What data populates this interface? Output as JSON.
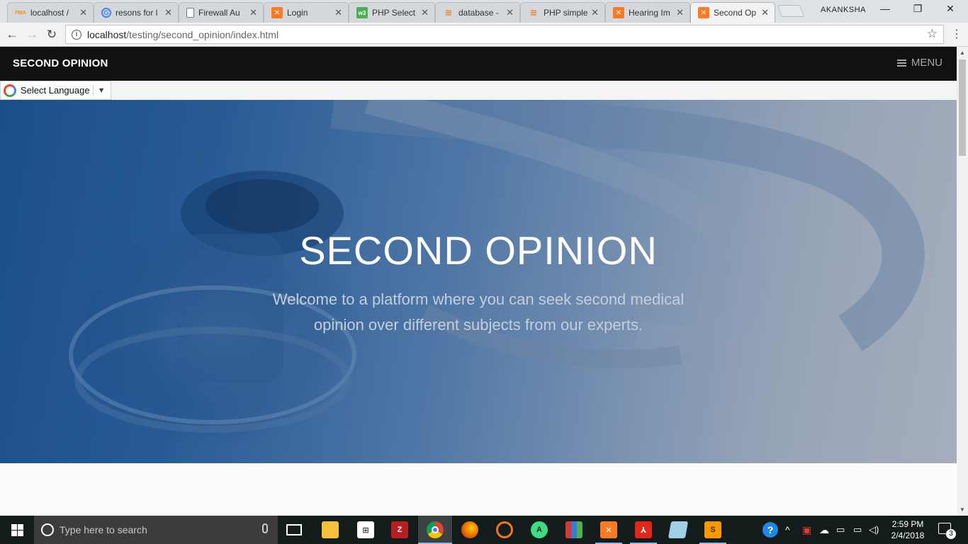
{
  "browser": {
    "tabs": [
      {
        "title": "localhost /",
        "favicon": "phpmyadmin-icon",
        "favicon_text": "PMA",
        "color": "#f29111"
      },
      {
        "title": "resons for l",
        "favicon": "google-icon",
        "favicon_text": "G",
        "color": "#4285f4"
      },
      {
        "title": "Firewall Au",
        "favicon": "document-icon",
        "favicon_text": "",
        "color": "#888888"
      },
      {
        "title": "Login",
        "favicon": "xampp-icon",
        "favicon_text": "☒",
        "color": "#fb7a24"
      },
      {
        "title": "PHP Select",
        "favicon": "w3schools-icon",
        "favicon_text": "w3",
        "color": "#4caf50"
      },
      {
        "title": "database -",
        "favicon": "stackoverflow-icon",
        "favicon_text": "≋",
        "color": "#f48024"
      },
      {
        "title": "PHP simple",
        "favicon": "stackoverflow-icon",
        "favicon_text": "≋",
        "color": "#f48024"
      },
      {
        "title": "Hearing Im",
        "favicon": "xampp-icon",
        "favicon_text": "☒",
        "color": "#fb7a24"
      },
      {
        "title": "Second Op",
        "favicon": "xampp-icon",
        "favicon_text": "☒",
        "color": "#fb7a24",
        "active": true
      }
    ],
    "profile": "AKANKSHA",
    "url_host": "localhost",
    "url_path": "/testing/second_opinion/index.html"
  },
  "page": {
    "brand": "SECOND OPINION",
    "menu_label": "MENU",
    "translate": {
      "label": "Select Language"
    },
    "hero": {
      "title": "SECOND OPINION",
      "subtitle": "Welcome to a platform where you can seek second medical opinion over different subjects from our experts."
    }
  },
  "taskbar": {
    "search_placeholder": "Type here to search",
    "time": "2:59 PM",
    "date": "2/4/2018",
    "notification_count": "3",
    "apps": [
      {
        "name": "task-view-icon"
      },
      {
        "name": "file-explorer-icon"
      },
      {
        "name": "store-icon"
      },
      {
        "name": "filezilla-icon"
      },
      {
        "name": "chrome-icon",
        "active": true
      },
      {
        "name": "firefox-icon"
      },
      {
        "name": "ubuntu-icon"
      },
      {
        "name": "android-studio-icon"
      },
      {
        "name": "winrar-icon"
      },
      {
        "name": "xampp-icon"
      },
      {
        "name": "acrobat-icon"
      },
      {
        "name": "notepad-icon"
      },
      {
        "name": "sublime-icon"
      }
    ]
  }
}
